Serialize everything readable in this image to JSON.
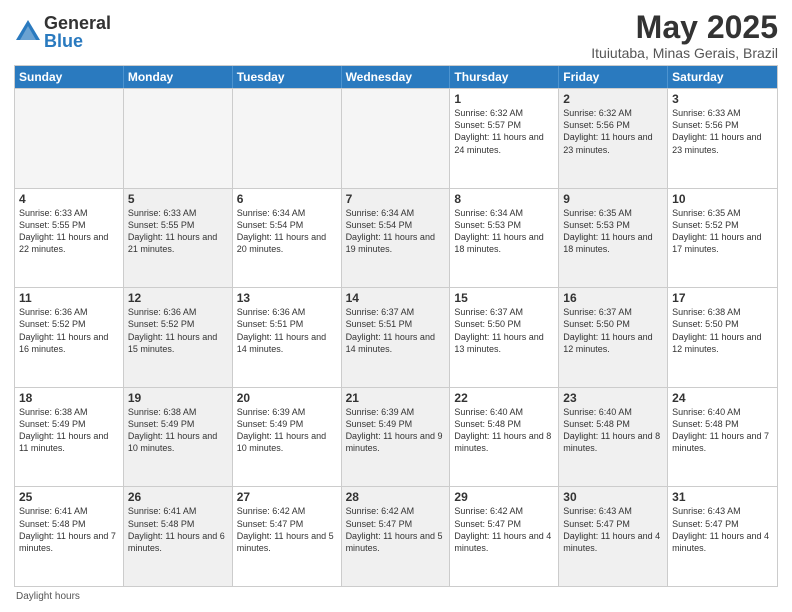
{
  "logo": {
    "general": "General",
    "blue": "Blue"
  },
  "title": "May 2025",
  "subtitle": "Ituiutaba, Minas Gerais, Brazil",
  "days_of_week": [
    "Sunday",
    "Monday",
    "Tuesday",
    "Wednesday",
    "Thursday",
    "Friday",
    "Saturday"
  ],
  "footer_label": "Daylight hours",
  "weeks": [
    [
      {
        "day": "",
        "sunrise": "",
        "sunset": "",
        "daylight": "",
        "empty": true
      },
      {
        "day": "",
        "sunrise": "",
        "sunset": "",
        "daylight": "",
        "empty": true
      },
      {
        "day": "",
        "sunrise": "",
        "sunset": "",
        "daylight": "",
        "empty": true
      },
      {
        "day": "",
        "sunrise": "",
        "sunset": "",
        "daylight": "",
        "empty": true
      },
      {
        "day": "1",
        "sunrise": "Sunrise: 6:32 AM",
        "sunset": "Sunset: 5:57 PM",
        "daylight": "Daylight: 11 hours and 24 minutes.",
        "empty": false,
        "shaded": false
      },
      {
        "day": "2",
        "sunrise": "Sunrise: 6:32 AM",
        "sunset": "Sunset: 5:56 PM",
        "daylight": "Daylight: 11 hours and 23 minutes.",
        "empty": false,
        "shaded": true
      },
      {
        "day": "3",
        "sunrise": "Sunrise: 6:33 AM",
        "sunset": "Sunset: 5:56 PM",
        "daylight": "Daylight: 11 hours and 23 minutes.",
        "empty": false,
        "shaded": false
      }
    ],
    [
      {
        "day": "4",
        "sunrise": "Sunrise: 6:33 AM",
        "sunset": "Sunset: 5:55 PM",
        "daylight": "Daylight: 11 hours and 22 minutes.",
        "empty": false,
        "shaded": false
      },
      {
        "day": "5",
        "sunrise": "Sunrise: 6:33 AM",
        "sunset": "Sunset: 5:55 PM",
        "daylight": "Daylight: 11 hours and 21 minutes.",
        "empty": false,
        "shaded": true
      },
      {
        "day": "6",
        "sunrise": "Sunrise: 6:34 AM",
        "sunset": "Sunset: 5:54 PM",
        "daylight": "Daylight: 11 hours and 20 minutes.",
        "empty": false,
        "shaded": false
      },
      {
        "day": "7",
        "sunrise": "Sunrise: 6:34 AM",
        "sunset": "Sunset: 5:54 PM",
        "daylight": "Daylight: 11 hours and 19 minutes.",
        "empty": false,
        "shaded": true
      },
      {
        "day": "8",
        "sunrise": "Sunrise: 6:34 AM",
        "sunset": "Sunset: 5:53 PM",
        "daylight": "Daylight: 11 hours and 18 minutes.",
        "empty": false,
        "shaded": false
      },
      {
        "day": "9",
        "sunrise": "Sunrise: 6:35 AM",
        "sunset": "Sunset: 5:53 PM",
        "daylight": "Daylight: 11 hours and 18 minutes.",
        "empty": false,
        "shaded": true
      },
      {
        "day": "10",
        "sunrise": "Sunrise: 6:35 AM",
        "sunset": "Sunset: 5:52 PM",
        "daylight": "Daylight: 11 hours and 17 minutes.",
        "empty": false,
        "shaded": false
      }
    ],
    [
      {
        "day": "11",
        "sunrise": "Sunrise: 6:36 AM",
        "sunset": "Sunset: 5:52 PM",
        "daylight": "Daylight: 11 hours and 16 minutes.",
        "empty": false,
        "shaded": false
      },
      {
        "day": "12",
        "sunrise": "Sunrise: 6:36 AM",
        "sunset": "Sunset: 5:52 PM",
        "daylight": "Daylight: 11 hours and 15 minutes.",
        "empty": false,
        "shaded": true
      },
      {
        "day": "13",
        "sunrise": "Sunrise: 6:36 AM",
        "sunset": "Sunset: 5:51 PM",
        "daylight": "Daylight: 11 hours and 14 minutes.",
        "empty": false,
        "shaded": false
      },
      {
        "day": "14",
        "sunrise": "Sunrise: 6:37 AM",
        "sunset": "Sunset: 5:51 PM",
        "daylight": "Daylight: 11 hours and 14 minutes.",
        "empty": false,
        "shaded": true
      },
      {
        "day": "15",
        "sunrise": "Sunrise: 6:37 AM",
        "sunset": "Sunset: 5:50 PM",
        "daylight": "Daylight: 11 hours and 13 minutes.",
        "empty": false,
        "shaded": false
      },
      {
        "day": "16",
        "sunrise": "Sunrise: 6:37 AM",
        "sunset": "Sunset: 5:50 PM",
        "daylight": "Daylight: 11 hours and 12 minutes.",
        "empty": false,
        "shaded": true
      },
      {
        "day": "17",
        "sunrise": "Sunrise: 6:38 AM",
        "sunset": "Sunset: 5:50 PM",
        "daylight": "Daylight: 11 hours and 12 minutes.",
        "empty": false,
        "shaded": false
      }
    ],
    [
      {
        "day": "18",
        "sunrise": "Sunrise: 6:38 AM",
        "sunset": "Sunset: 5:49 PM",
        "daylight": "Daylight: 11 hours and 11 minutes.",
        "empty": false,
        "shaded": false
      },
      {
        "day": "19",
        "sunrise": "Sunrise: 6:38 AM",
        "sunset": "Sunset: 5:49 PM",
        "daylight": "Daylight: 11 hours and 10 minutes.",
        "empty": false,
        "shaded": true
      },
      {
        "day": "20",
        "sunrise": "Sunrise: 6:39 AM",
        "sunset": "Sunset: 5:49 PM",
        "daylight": "Daylight: 11 hours and 10 minutes.",
        "empty": false,
        "shaded": false
      },
      {
        "day": "21",
        "sunrise": "Sunrise: 6:39 AM",
        "sunset": "Sunset: 5:49 PM",
        "daylight": "Daylight: 11 hours and 9 minutes.",
        "empty": false,
        "shaded": true
      },
      {
        "day": "22",
        "sunrise": "Sunrise: 6:40 AM",
        "sunset": "Sunset: 5:48 PM",
        "daylight": "Daylight: 11 hours and 8 minutes.",
        "empty": false,
        "shaded": false
      },
      {
        "day": "23",
        "sunrise": "Sunrise: 6:40 AM",
        "sunset": "Sunset: 5:48 PM",
        "daylight": "Daylight: 11 hours and 8 minutes.",
        "empty": false,
        "shaded": true
      },
      {
        "day": "24",
        "sunrise": "Sunrise: 6:40 AM",
        "sunset": "Sunset: 5:48 PM",
        "daylight": "Daylight: 11 hours and 7 minutes.",
        "empty": false,
        "shaded": false
      }
    ],
    [
      {
        "day": "25",
        "sunrise": "Sunrise: 6:41 AM",
        "sunset": "Sunset: 5:48 PM",
        "daylight": "Daylight: 11 hours and 7 minutes.",
        "empty": false,
        "shaded": false
      },
      {
        "day": "26",
        "sunrise": "Sunrise: 6:41 AM",
        "sunset": "Sunset: 5:48 PM",
        "daylight": "Daylight: 11 hours and 6 minutes.",
        "empty": false,
        "shaded": true
      },
      {
        "day": "27",
        "sunrise": "Sunrise: 6:42 AM",
        "sunset": "Sunset: 5:47 PM",
        "daylight": "Daylight: 11 hours and 5 minutes.",
        "empty": false,
        "shaded": false
      },
      {
        "day": "28",
        "sunrise": "Sunrise: 6:42 AM",
        "sunset": "Sunset: 5:47 PM",
        "daylight": "Daylight: 11 hours and 5 minutes.",
        "empty": false,
        "shaded": true
      },
      {
        "day": "29",
        "sunrise": "Sunrise: 6:42 AM",
        "sunset": "Sunset: 5:47 PM",
        "daylight": "Daylight: 11 hours and 4 minutes.",
        "empty": false,
        "shaded": false
      },
      {
        "day": "30",
        "sunrise": "Sunrise: 6:43 AM",
        "sunset": "Sunset: 5:47 PM",
        "daylight": "Daylight: 11 hours and 4 minutes.",
        "empty": false,
        "shaded": true
      },
      {
        "day": "31",
        "sunrise": "Sunrise: 6:43 AM",
        "sunset": "Sunset: 5:47 PM",
        "daylight": "Daylight: 11 hours and 4 minutes.",
        "empty": false,
        "shaded": false
      }
    ]
  ]
}
